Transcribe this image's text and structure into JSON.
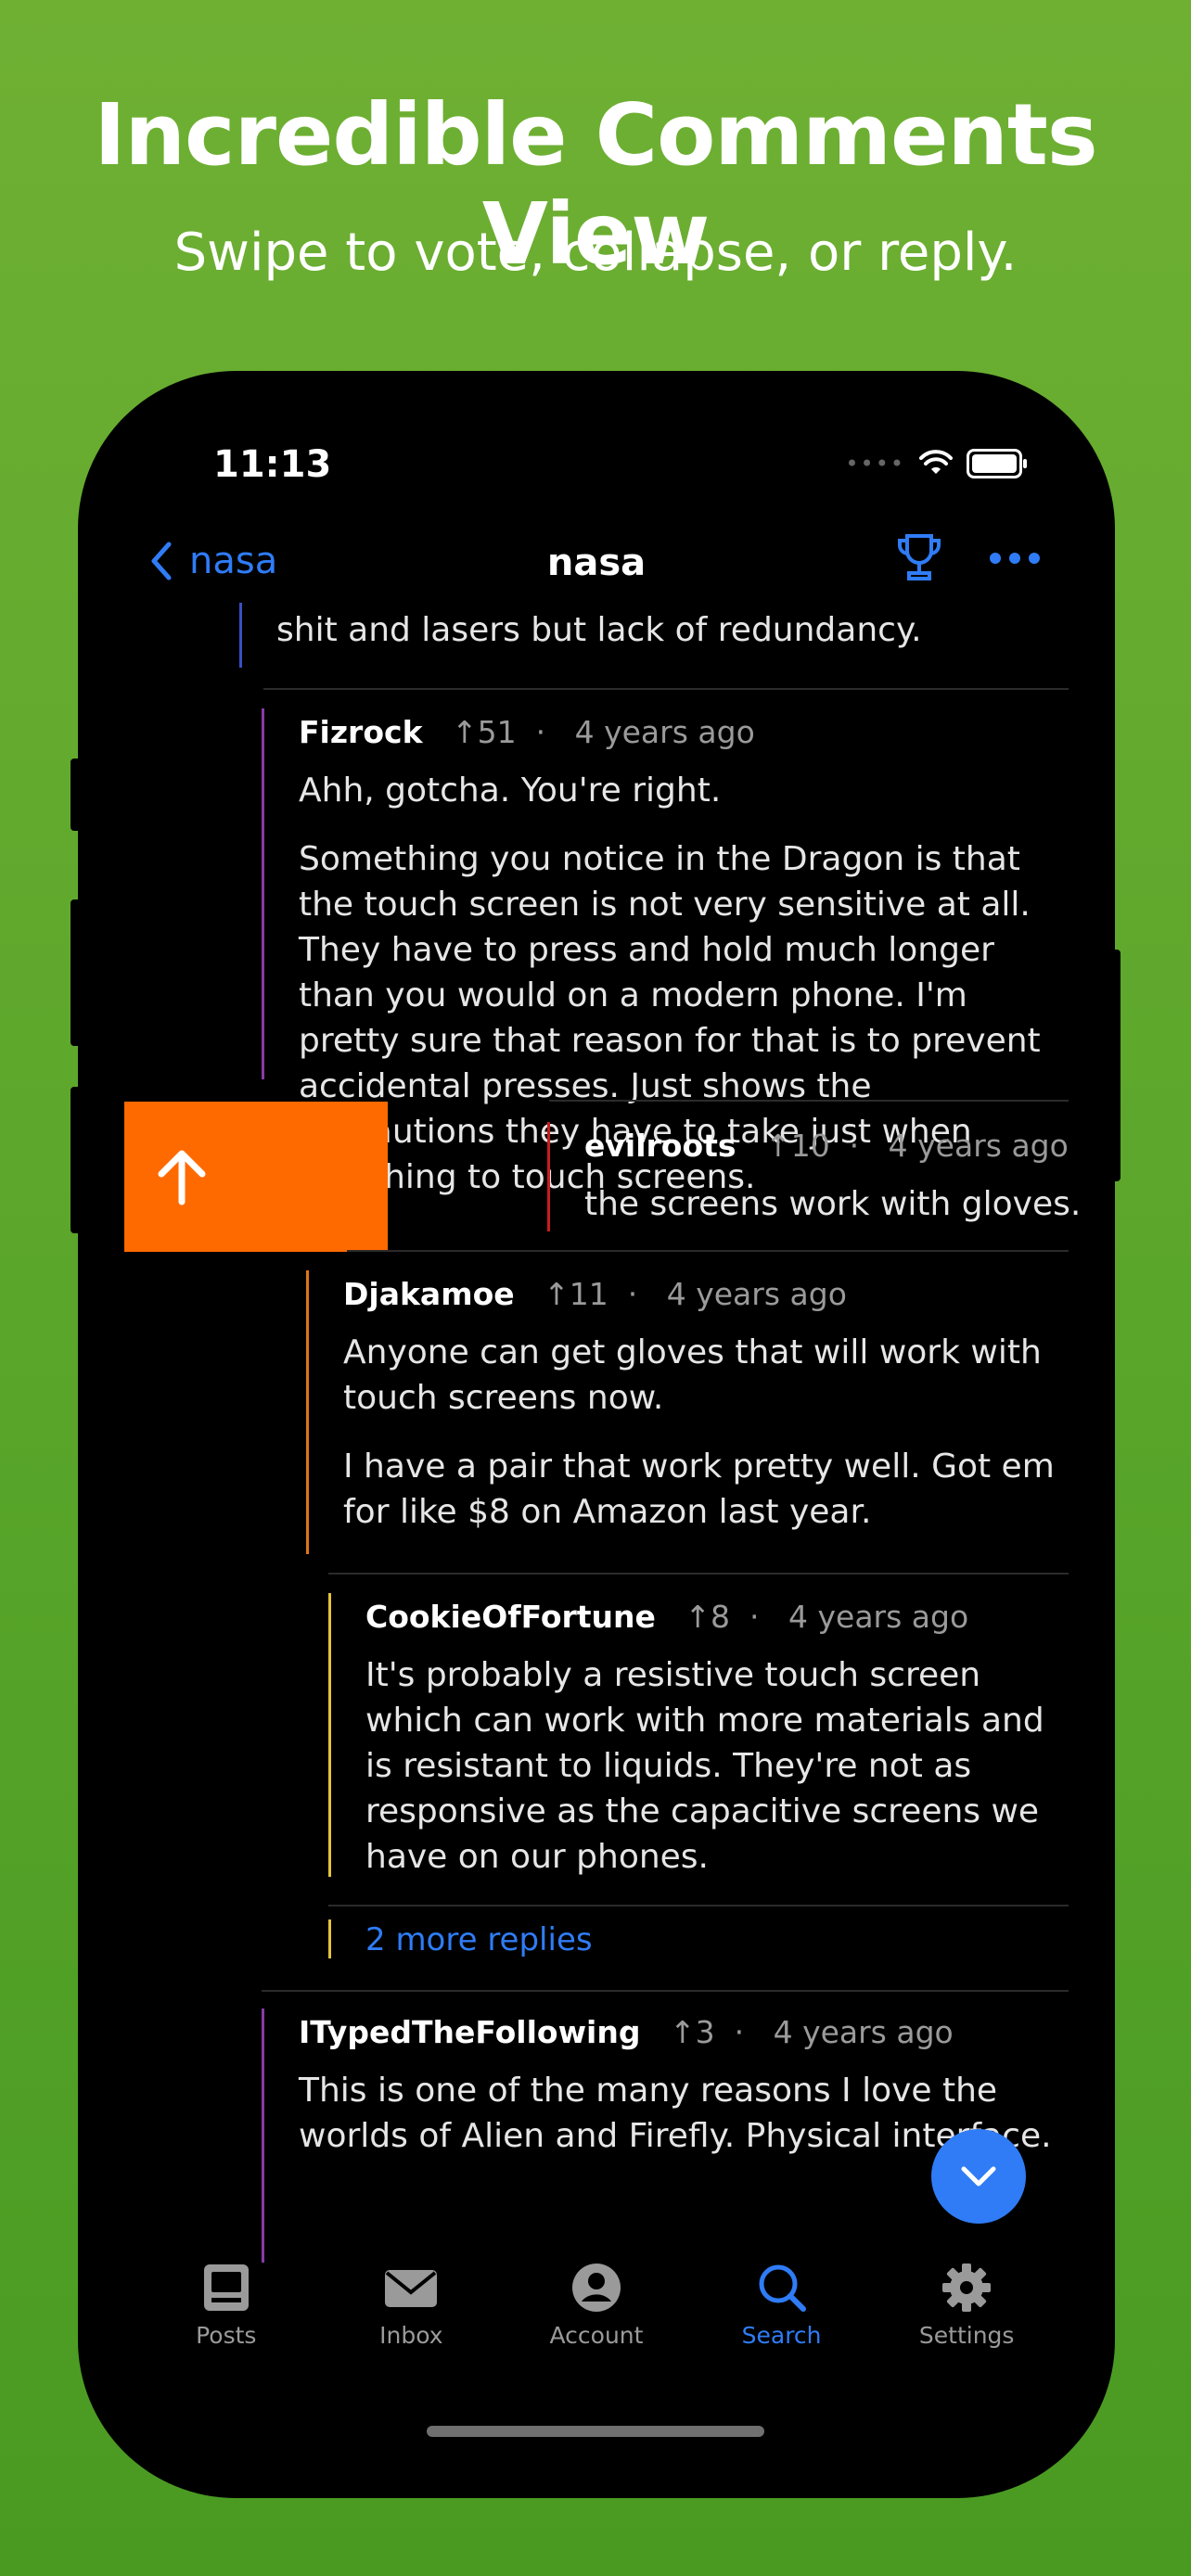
{
  "marketing": {
    "headline": "Incredible Comments View",
    "subheadline": "Swipe to vote, collapse, or reply."
  },
  "status_bar": {
    "time": "11:13"
  },
  "nav": {
    "back_label": "nasa",
    "title": "nasa"
  },
  "comments": {
    "partial_text": "shit and lasers but lack of redundancy.",
    "c1": {
      "author": "Fizrock",
      "votes": "↑51",
      "age": "4 years ago",
      "p1": "Ahh, gotcha. You're right.",
      "p2": "Something you notice in the Dragon is that the touch screen is not very sensitive at all. They have to press and hold much longer than you would on a modern phone. I'm pretty sure that reason for that is to prevent accidental presses. Just shows the precautions they have to take just when switching to touch screens."
    },
    "c2": {
      "author": "evilroots",
      "votes": "↑10",
      "age": "4 years ago",
      "p1": "the screens work with gloves."
    },
    "c3": {
      "author": "Djakamoe",
      "votes": "↑11",
      "age": "4 years ago",
      "p1": "Anyone can get gloves that will work with touch screens now.",
      "p2": "I have a pair that work pretty well. Got em for like $8 on Amazon last year."
    },
    "c4": {
      "author": "CookieOfFortune",
      "votes": "↑8",
      "age": "4 years ago",
      "p1": "It's probably a resistive touch screen which can work with more materials and is resistant to liquids. They're not as responsive as the capacitive screens we have on our phones."
    },
    "more_replies": "2 more replies",
    "c5": {
      "author": "ITypedTheFollowing",
      "votes": "↑3",
      "age": "4 years ago",
      "p1": "This is one of the many reasons I love the worlds of Alien and Firefly. Physical interface."
    },
    "thread_colors": [
      "#3a4fc4",
      "#8a3aa8",
      "#c91d1d",
      "#e0751a",
      "#e5c33a",
      "#8a3aa8"
    ]
  },
  "tabs": [
    {
      "label": "Posts",
      "icon": "posts-icon"
    },
    {
      "label": "Inbox",
      "icon": "inbox-icon"
    },
    {
      "label": "Account",
      "icon": "account-icon"
    },
    {
      "label": "Search",
      "icon": "search-icon",
      "active": true
    },
    {
      "label": "Settings",
      "icon": "settings-icon"
    }
  ],
  "colors": {
    "accent": "#2f7cf6",
    "swipe_action": "#ff6a00",
    "background_top": "#6fb033"
  }
}
